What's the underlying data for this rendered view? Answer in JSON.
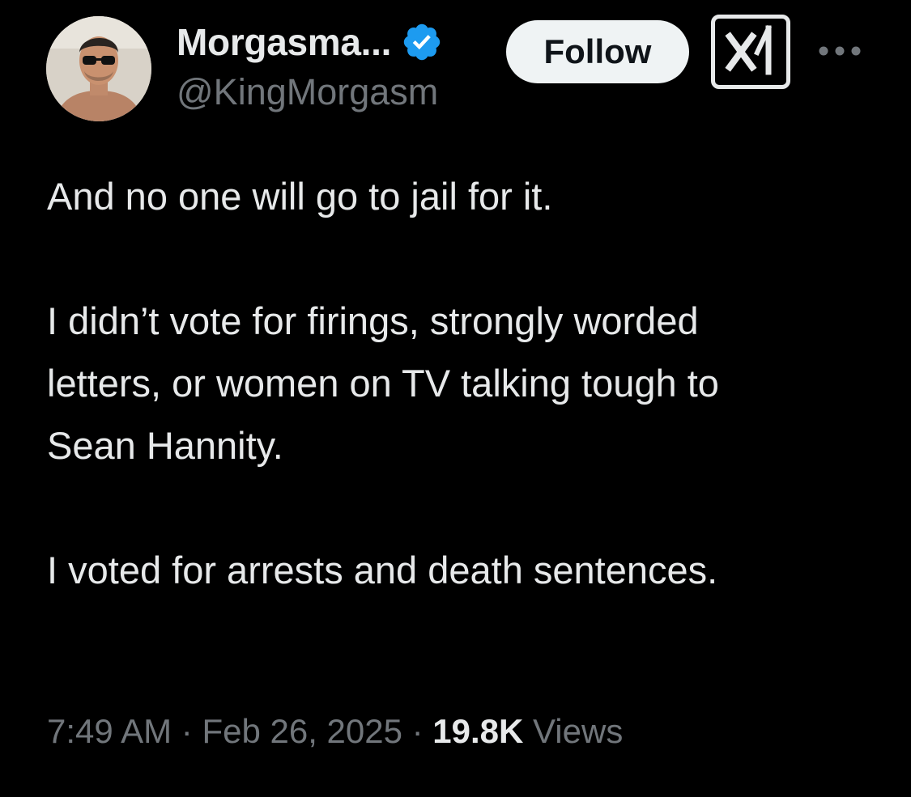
{
  "author": {
    "display_name": "Morgasma...",
    "handle": "@KingMorgasm",
    "verified": true,
    "verified_color": "#1d9bf0"
  },
  "actions": {
    "follow_label": "Follow",
    "grok_icon": "grok-icon",
    "more_icon": "more-horizontal-icon"
  },
  "tweet": {
    "paragraphs": [
      "And no one will go to jail for it.",
      "I didn’t vote for firings, strongly worded letters, or women on TV talking tough to Sean Hannity.",
      "I voted for arrests and death sentences."
    ]
  },
  "meta": {
    "time": "7:49 AM",
    "date": "Feb 26, 2025",
    "separator": " · ",
    "views_count": "19.8K",
    "views_label": "Views"
  },
  "colors": {
    "background": "#000000",
    "primary_text": "#e7e9ea",
    "secondary_text": "#71767b",
    "follow_button_bg": "#eff3f4"
  }
}
